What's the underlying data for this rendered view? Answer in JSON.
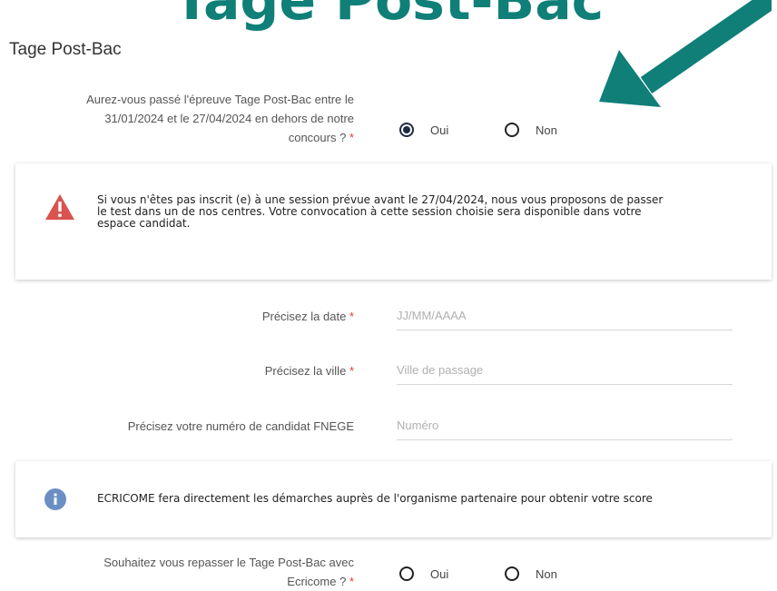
{
  "banner": {
    "heading": "Tage Post-Bac",
    "color": "#0f7f78"
  },
  "section": {
    "title": "Tage Post-Bac"
  },
  "question1": {
    "line1": "Aurez-vous passé l'épreuve Tage Post-Bac entre le",
    "line2": "31/01/2024 et le 27/04/2024 en dehors de notre",
    "line3": "concours ?",
    "required": "*",
    "options": [
      {
        "label": "Oui",
        "selected": true
      },
      {
        "label": "Non",
        "selected": false
      }
    ]
  },
  "warning": {
    "icon": "warning-triangle-icon",
    "color": "#d9534f",
    "line1": "Si vous n'êtes pas inscrit (e) à une session prévue avant le 27/04/2024, nous vous proposons de passer",
    "line2": "le test dans un de nos centres. Votre convocation à cette session choisie sera disponible dans votre",
    "line3": "espace candidat."
  },
  "fields": {
    "date": {
      "label": "Précisez la date",
      "required": "*",
      "placeholder": "JJ/MM/AAAA",
      "value": ""
    },
    "city": {
      "label": "Précisez la ville",
      "required": "*",
      "placeholder": "Ville de passage",
      "value": ""
    },
    "candidate": {
      "label": "Précisez votre numéro de candidat FNEGE",
      "placeholder": "Numéro",
      "value": ""
    }
  },
  "info": {
    "icon": "info-icon",
    "color": "#6b8fc4",
    "text": "ECRICOME fera directement les démarches auprès de l'organisme partenaire pour obtenir votre score"
  },
  "question2": {
    "line1": "Souhaitez vous repasser le Tage Post-Bac avec",
    "line2": "Ecricome ?",
    "required": "*",
    "options": [
      {
        "label": "Oui",
        "selected": false
      },
      {
        "label": "Non",
        "selected": false
      }
    ]
  },
  "annotation": {
    "icon": "arrow-icon",
    "color": "#0f7f78"
  }
}
